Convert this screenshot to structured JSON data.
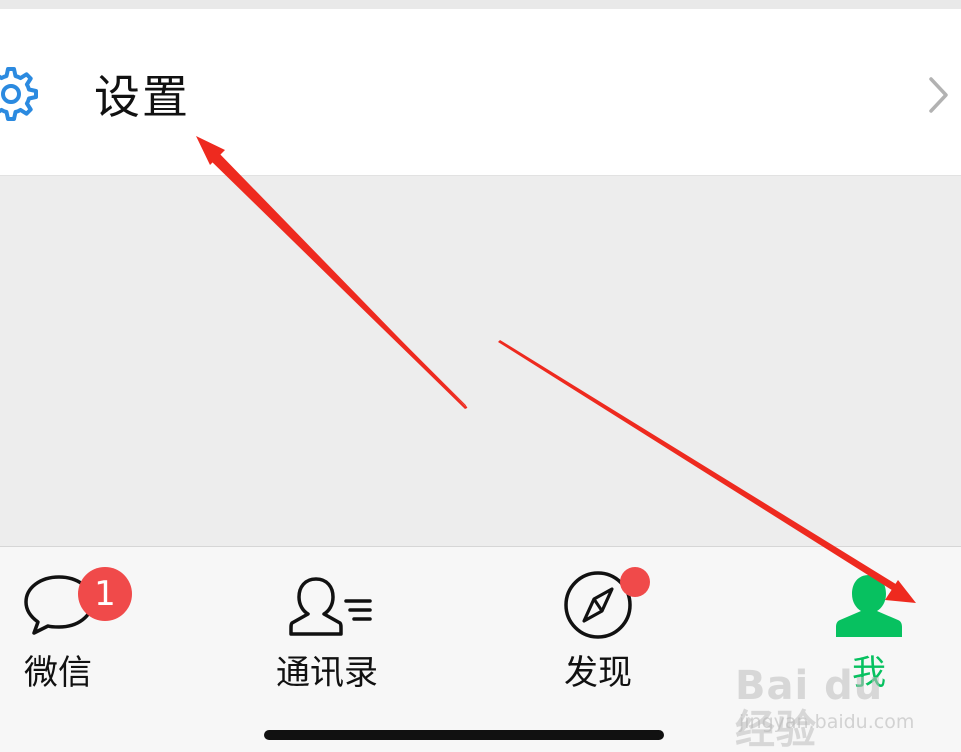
{
  "settings": {
    "label": "设置",
    "icon": "gear-icon",
    "chevron_icon": "chevron-right-icon"
  },
  "tabbar": {
    "tabs": [
      {
        "label": "微信",
        "icon": "chat-bubble-icon",
        "badge": "1",
        "active": false
      },
      {
        "label": "通讯录",
        "icon": "contacts-icon",
        "active": false
      },
      {
        "label": "发现",
        "icon": "compass-icon",
        "dot": true,
        "active": false
      },
      {
        "label": "我",
        "icon": "person-icon",
        "active": true
      }
    ]
  },
  "watermark": {
    "brand": "Bai du 经验",
    "subtitle": "jingyan.baidu.com"
  },
  "colors": {
    "active_green": "#07c160",
    "badge_red": "#f04a4a",
    "gear_blue": "#2b8ae0",
    "annotation_red": "#ee2a1f",
    "background_gray": "#ededed"
  }
}
